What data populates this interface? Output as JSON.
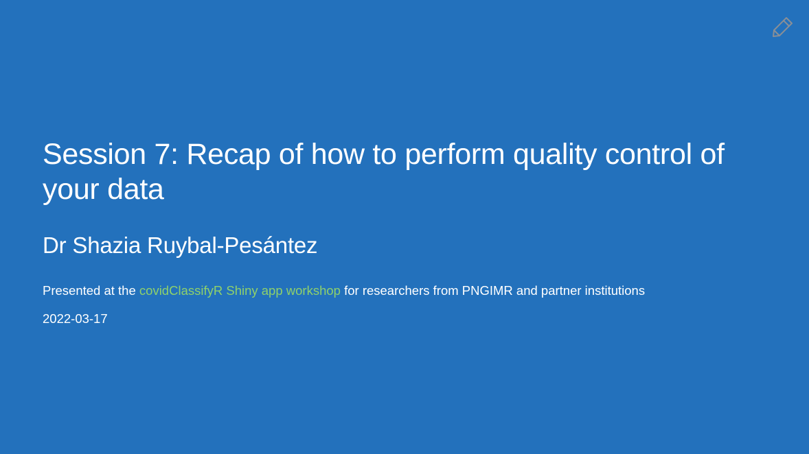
{
  "slide": {
    "title": "Session 7: Recap of how to perform quality control of your data",
    "author": "Dr Shazia Ruybal-Pesántez",
    "presented_prefix": "Presented at the ",
    "workshop_link": "covidClassifyR Shiny app workshop",
    "presented_suffix": " for researchers from PNGIMR and partner institutions",
    "date": "2022-03-17"
  },
  "toolbar": {
    "edit_icon": "pencil-icon"
  },
  "colors": {
    "background": "#2371bc",
    "text": "#ffffff",
    "link": "#8fd16b",
    "icon": "#8a8f96"
  }
}
